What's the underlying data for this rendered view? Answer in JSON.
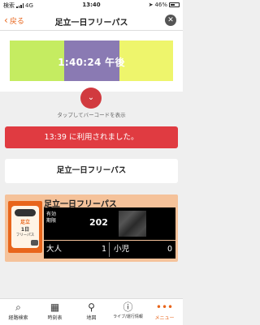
{
  "status_bar": {
    "carrier": "検索",
    "network": "4G",
    "time": "13:40",
    "battery": "46%"
  },
  "nav": {
    "back_label": "戻る",
    "title": "足立一日フリーパス",
    "close_symbol": "✕"
  },
  "animation": {
    "time_text": "1:40:24 午後",
    "colors": {
      "green": "#c5ec61",
      "purple": "#8a7ab3",
      "yellow": "#eef56c"
    }
  },
  "barcode_hint": "タップしてバーコードを表示",
  "used_banner": "13:39 に利用されました。",
  "pass_button": "足立一日フリーパス",
  "ticket": {
    "title": "足立一日フリーパス",
    "logo_text": [
      "足立",
      "1日",
      "フリーパス"
    ],
    "expiry_label": [
      "有効",
      "期限"
    ],
    "expiry_year": "202",
    "adult_label": "大人",
    "adult_count": "1",
    "child_label": "小児",
    "child_count": "0"
  },
  "tabs": [
    {
      "label": "経路検索",
      "icon": "route-search-icon"
    },
    {
      "label": "時刻表",
      "icon": "timetable-icon"
    },
    {
      "label": "地図",
      "icon": "map-pin-icon"
    },
    {
      "label": "ライブ/運行情報",
      "icon": "live-info-icon"
    },
    {
      "label": "メニュー",
      "icon": "more-dots-icon"
    }
  ]
}
